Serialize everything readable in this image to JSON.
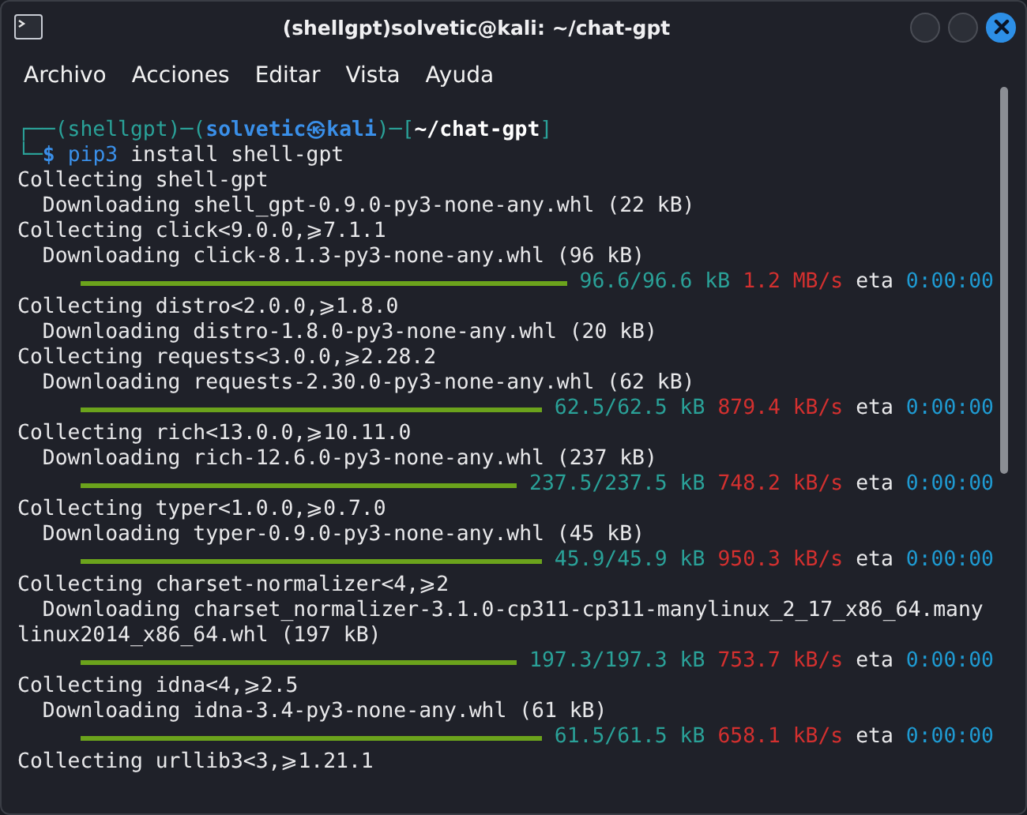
{
  "window": {
    "title": "(shellgpt)solvetic@kali: ~/chat-gpt"
  },
  "menu": [
    "Archivo",
    "Acciones",
    "Editar",
    "Vista",
    "Ayuda"
  ],
  "prompt": [
    [
      {
        "text": "┌──(",
        "kind": "frame"
      },
      {
        "text": "shellgpt",
        "kind": "env"
      },
      {
        "text": ")─(",
        "kind": "frame"
      },
      {
        "text": "solvetic㉿kali",
        "kind": "host"
      },
      {
        "text": ")─[",
        "kind": "frame"
      },
      {
        "text": "~/chat-gpt",
        "kind": "path"
      },
      {
        "text": "]",
        "kind": "frame"
      }
    ],
    [
      {
        "text": "└─",
        "kind": "frame"
      },
      {
        "text": "$",
        "kind": "dollar"
      },
      {
        "text": "pip3",
        "kind": "command"
      },
      {
        "text": "install shell-gpt",
        "kind": "plain"
      }
    ]
  ],
  "output": [
    {
      "kind": "text",
      "text": "Collecting shell-gpt"
    },
    {
      "kind": "text",
      "text": "  Downloading shell_gpt-0.9.0-py3-none-any.whl (22 kB)"
    },
    {
      "kind": "text",
      "text": "Collecting click<9.0.0,⩾7.1.1"
    },
    {
      "kind": "text",
      "text": "  Downloading click-8.1.3-py3-none-any.whl (96 kB)"
    },
    {
      "kind": "progress",
      "level": 1,
      "size": "96.6/96.6 kB",
      "speed": "1.2 MB/s",
      "eta_label": "eta",
      "eta": "0:00:00"
    },
    {
      "kind": "text",
      "text": "Collecting distro<2.0.0,⩾1.8.0"
    },
    {
      "kind": "text",
      "text": "  Downloading distro-1.8.0-py3-none-any.whl (20 kB)"
    },
    {
      "kind": "text",
      "text": "Collecting requests<3.0.0,⩾2.28.2"
    },
    {
      "kind": "text",
      "text": "  Downloading requests-2.30.0-py3-none-any.whl (62 kB)"
    },
    {
      "kind": "progress",
      "level": 1,
      "size": "62.5/62.5 kB",
      "speed": "879.4 kB/s",
      "eta_label": "eta",
      "eta": "0:00:00"
    },
    {
      "kind": "text",
      "text": "Collecting rich<13.0.0,⩾10.11.0"
    },
    {
      "kind": "text",
      "text": "  Downloading rich-12.6.0-py3-none-any.whl (237 kB)"
    },
    {
      "kind": "progress",
      "level": 1,
      "size": "237.5/237.5 kB",
      "speed": "748.2 kB/s",
      "eta_label": "eta",
      "eta": "0:00:00"
    },
    {
      "kind": "text",
      "text": "Collecting typer<1.0.0,⩾0.7.0"
    },
    {
      "kind": "text",
      "text": "  Downloading typer-0.9.0-py3-none-any.whl (45 kB)"
    },
    {
      "kind": "progress",
      "level": 1,
      "size": "45.9/45.9 kB",
      "speed": "950.3 kB/s",
      "eta_label": "eta",
      "eta": "0:00:00"
    },
    {
      "kind": "text",
      "text": "Collecting charset-normalizer<4,⩾2"
    },
    {
      "kind": "text",
      "text": "  Downloading charset_normalizer-3.1.0-cp311-cp311-manylinux_2_17_x86_64.many"
    },
    {
      "kind": "text",
      "text": "linux2014_x86_64.whl (197 kB)"
    },
    {
      "kind": "progress",
      "level": 1,
      "size": "197.3/197.3 kB",
      "speed": "753.7 kB/s",
      "eta_label": "eta",
      "eta": "0:00:00"
    },
    {
      "kind": "text",
      "text": "Collecting idna<4,⩾2.5"
    },
    {
      "kind": "text",
      "text": "  Downloading idna-3.4-py3-none-any.whl (61 kB)"
    },
    {
      "kind": "progress",
      "level": 1,
      "size": "61.5/61.5 kB",
      "speed": "658.1 kB/s",
      "eta_label": "eta",
      "eta": "0:00:00"
    },
    {
      "kind": "text",
      "text": "Collecting urllib3<3,⩾1.21.1"
    }
  ]
}
